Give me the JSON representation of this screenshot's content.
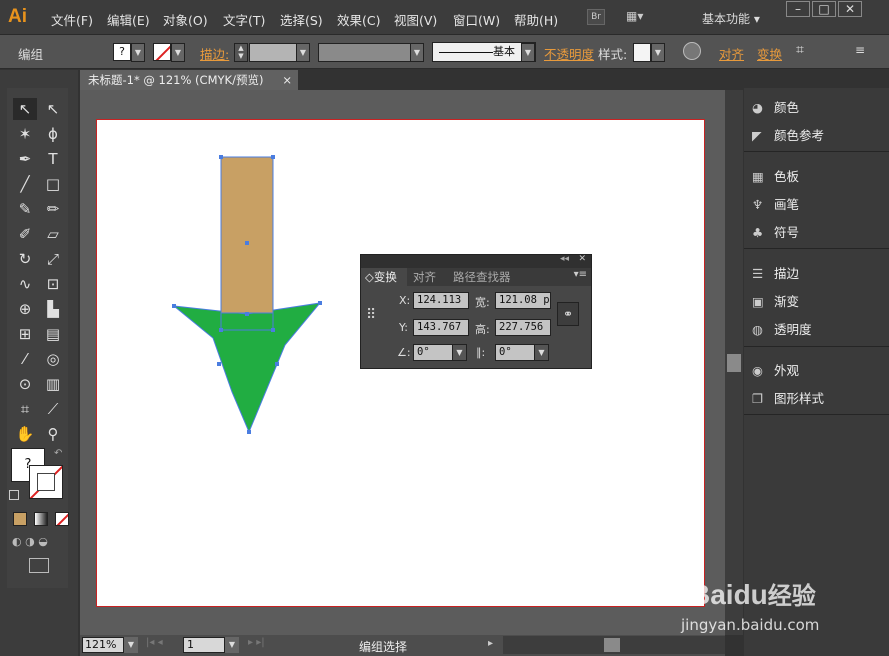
{
  "app": {
    "logo": "Ai",
    "workspace": "基本功能",
    "bridge": "Br"
  },
  "menu": [
    "文件(F)",
    "编辑(E)",
    "对象(O)",
    "文字(T)",
    "选择(S)",
    "效果(C)",
    "视图(V)",
    "窗口(W)",
    "帮助(H)"
  ],
  "control": {
    "selection": "编组",
    "stroke": "描边:",
    "stroke_profile": "基本",
    "opacity": "不透明度",
    "style": "样式:",
    "align": "对齐",
    "transform": "变换"
  },
  "document": {
    "tab": "未标题-1* @ 121% (CMYK/预览)",
    "close": "×"
  },
  "panels": [
    {
      "label": "颜色",
      "icon": "palette-icon"
    },
    {
      "label": "颜色参考",
      "icon": "color-guide-icon"
    },
    {
      "label": "色板",
      "icon": "swatches-icon"
    },
    {
      "label": "画笔",
      "icon": "brush-icon"
    },
    {
      "label": "符号",
      "icon": "club-icon"
    },
    {
      "label": "描边",
      "icon": "stroke-lines-icon"
    },
    {
      "label": "渐变",
      "icon": "gradient-icon"
    },
    {
      "label": "透明度",
      "icon": "transparency-icon"
    },
    {
      "label": "外观",
      "icon": "appearance-icon"
    },
    {
      "label": "图形样式",
      "icon": "graphic-styles-icon"
    }
  ],
  "transform_panel": {
    "tabs": [
      "变换",
      "对齐",
      "路径查找器"
    ],
    "x_label": "X:",
    "x": "124.113",
    "w_label": "宽:",
    "w": "121.08 p",
    "y_label": "Y:",
    "y": "143.767",
    "h_label": "高:",
    "h": "227.756",
    "rotate": "0°",
    "shear": "0°"
  },
  "status": {
    "zoom": "121%",
    "page": "1",
    "mode": "编组选择"
  },
  "colors": {
    "fill_rect": "#c8a064",
    "fill_arrow": "#21ad42",
    "artboard_border": "#c82222",
    "accent": "#e8931d"
  },
  "watermark": {
    "brand": "Baidu",
    "cn": "经验",
    "url": "jingyan.baidu.com"
  }
}
